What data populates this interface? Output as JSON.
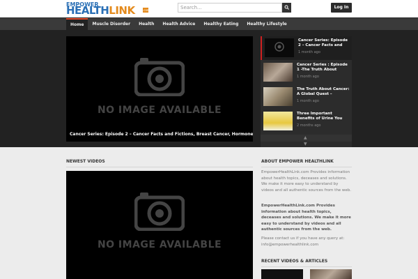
{
  "header": {
    "logo_top": "EMPOWER",
    "logo_health": "HEALTH",
    "logo_link": "LINK",
    "logo_com": ".com",
    "search_placeholder": "Search...",
    "login_label": "Log In"
  },
  "nav": {
    "items": [
      "Home",
      "Muscle Disorder",
      "Health",
      "Health Advice",
      "Healthy Eating",
      "Healthy Lifestyle"
    ]
  },
  "hero": {
    "no_image_text": "NO IMAGE AVAILABLE",
    "caption": "Cancer Series: Episode 2 – Cancer Facts and Fictions, Breast Cancer, Hormones,"
  },
  "playlist": {
    "items": [
      {
        "title": "Cancer Series: Episode 2 – Cancer Facts and",
        "date": "1 month ago"
      },
      {
        "title": "Cancer Series : Episode 1 -The Truth About",
        "date": "1 month ago"
      },
      {
        "title": "The Truth About Cancer: A Global Quest – Episode",
        "date": "1 month ago"
      },
      {
        "title": "Three Important Benefits of Urine You",
        "date": "2 months ago"
      }
    ],
    "thumb_no_image": "NO IMAGE AVAILABLE"
  },
  "newest": {
    "title": "NEWEST VIDEOS",
    "no_image_text": "NO IMAGE AVAILABLE"
  },
  "about": {
    "title": "ABOUT EMPOWER HEALTHLINK",
    "para1": "EmpowerHealthLink.com Provides information about health topics, deceases and solutions. We make it more easy to understand by videos and all authentic sources from the web.",
    "para2": "EmpowerHealthLink.com Provides information about health topics, deceases and solutions. We make it more easy to understand by videos and all authentic sources from the web.",
    "para3": "Please contact us if you have any query at: info@empowerhealthlink.com"
  },
  "recent": {
    "title": "RECENT VIDEOS & ARTICLES"
  },
  "colors": {
    "brand_blue": "#2a6fb5",
    "brand_orange": "#e48a1c",
    "active_red": "#d02020"
  }
}
